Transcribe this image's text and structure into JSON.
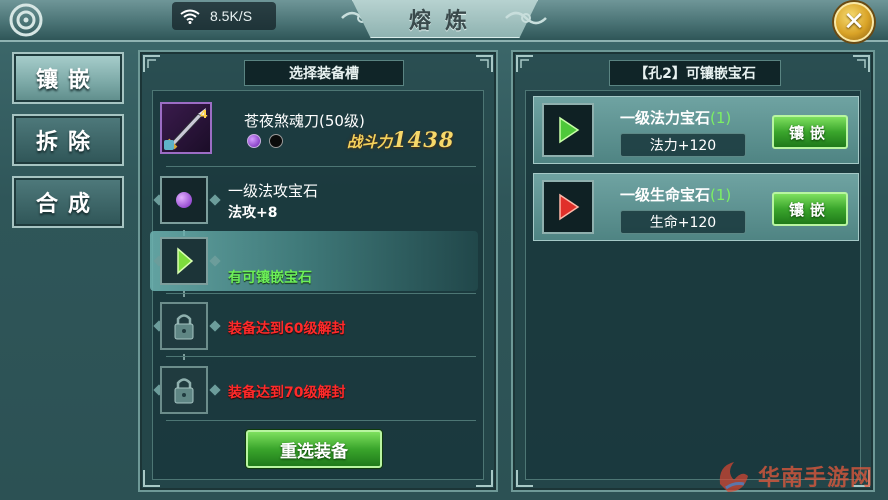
{
  "topbar": {
    "network_speed": "8.5K/S",
    "title": "熔炼"
  },
  "tabs": [
    {
      "label": "镶嵌",
      "active": true
    },
    {
      "label": "拆除",
      "active": false
    },
    {
      "label": "合成",
      "active": false
    }
  ],
  "left_panel": {
    "header": "选择装备槽",
    "equipment": {
      "name": "苍夜煞魂刀(50级)",
      "power_label": "战斗力",
      "power_value": "1438",
      "socket_colors": [
        "#8a3fd0",
        "#101010"
      ]
    },
    "slots": [
      {
        "title": "一级法攻宝石",
        "stat": "法攻+8",
        "state": "filled"
      },
      {
        "message": "有可镶嵌宝石",
        "state": "available"
      },
      {
        "message": "装备达到60级解封",
        "state": "locked"
      },
      {
        "message": "装备达到70级解封",
        "state": "locked"
      }
    ],
    "reselect_button": "重选装备"
  },
  "right_panel": {
    "header": "【孔2】可镶嵌宝石",
    "gems": [
      {
        "name": "一级法力宝石",
        "level": "(1)",
        "stat": "法力+120",
        "button": "镶嵌",
        "color": "#4ec83a"
      },
      {
        "name": "一级生命宝石",
        "level": "(1)",
        "stat": "生命+120",
        "button": "镶嵌",
        "color": "#e0302a"
      }
    ]
  },
  "watermark": {
    "text": "华南手游网"
  },
  "colors": {
    "accent_green": "#6cef58",
    "lock_red": "#ff2a2a",
    "gold": "#f6d86a"
  }
}
